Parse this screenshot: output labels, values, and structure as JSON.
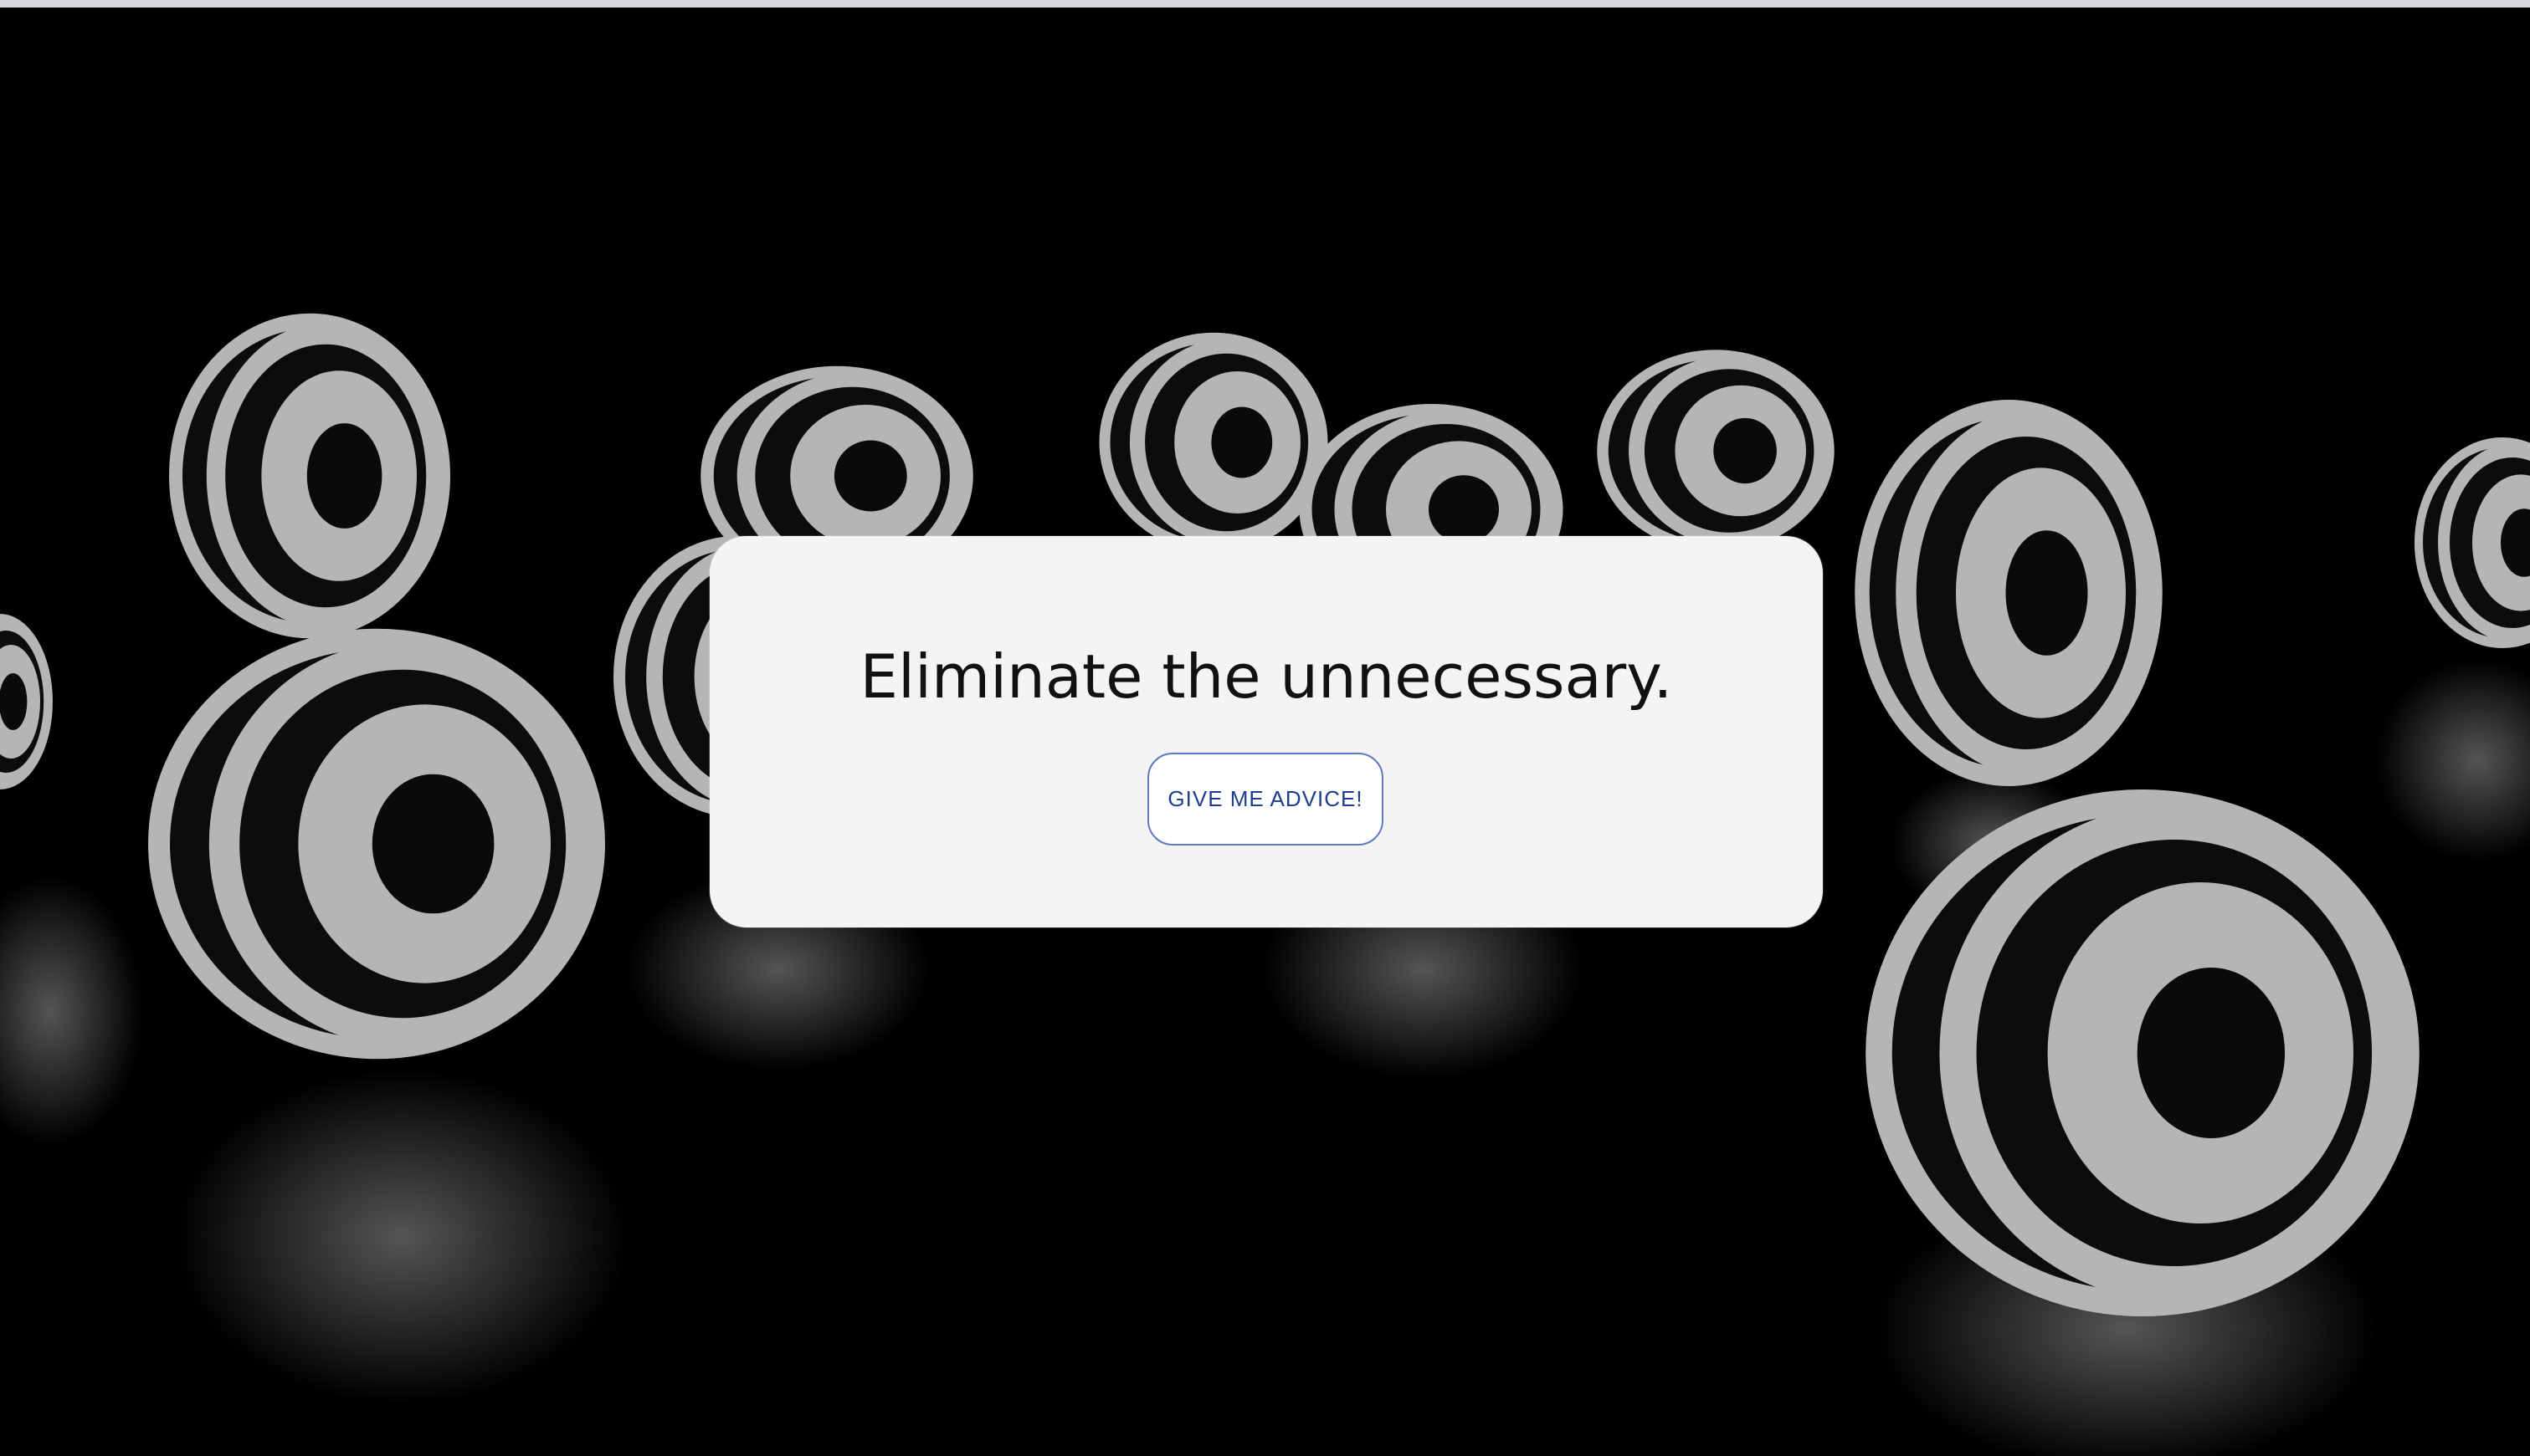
{
  "card": {
    "quote": "Eliminate the unnecessary.",
    "button_label": "GIVE ME ADVICE!"
  },
  "colors": {
    "background": "#000000",
    "card": "#f4f4f4",
    "button_border": "#5a7bc0",
    "button_text": "#1e3f8f"
  }
}
